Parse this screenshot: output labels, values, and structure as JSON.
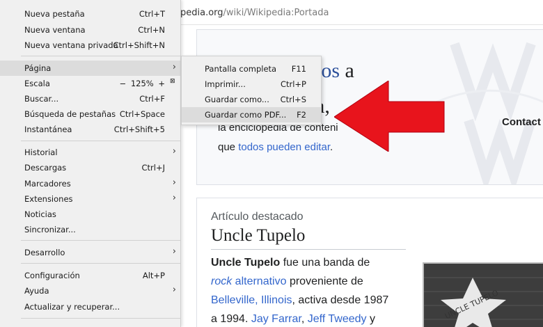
{
  "url": {
    "host_partial": "pedia.org",
    "path": "/wiki/Wikipedia:Portada"
  },
  "welcome": {
    "title_link": "los",
    "title_tail": " a",
    "line2": "a,",
    "line3": "la enciclopedia de conteni",
    "line4_pre": "que ",
    "line4_link": "todos pueden editar",
    "line4_post": ".",
    "contact": "Contact"
  },
  "featured": {
    "heading": "Artículo destacado",
    "title": "Uncle Tupelo",
    "line1_bold": "Uncle Tupelo",
    "line1_rest": " fue una banda de",
    "line2_link_i": "rock",
    "line2_link": " alternativo",
    "line2_rest": " proveniente de",
    "line3_link": "Belleville, Illinois",
    "line3_rest": ", activa desde 1987",
    "line4_pre": "a 1994. ",
    "line4_link1": "Jay Farrar",
    "line4_sep": ", ",
    "line4_link2": "Jeff Tweedy",
    "line4_post": " y",
    "image_text": "UNCLE TUPELO"
  },
  "menu": {
    "new_tab": "Nueva pestaña",
    "new_tab_key": "Ctrl+T",
    "new_window": "Nueva ventana",
    "new_window_key": "Ctrl+N",
    "new_private": "Nueva ventana privada",
    "new_private_key": "Ctrl+Shift+N",
    "page": "Página",
    "zoom": "Escala",
    "zoom_minus": "−",
    "zoom_value": "125%",
    "zoom_plus": "+",
    "find": "Buscar...",
    "find_key": "Ctrl+F",
    "tab_search": "Búsqueda de pestañas",
    "tab_search_key": "Ctrl+Space",
    "snapshot": "Instantánea",
    "snapshot_key": "Ctrl+Shift+5",
    "history": "Historial",
    "downloads": "Descargas",
    "downloads_key": "Ctrl+J",
    "bookmarks": "Marcadores",
    "extensions": "Extensiones",
    "news": "Noticias",
    "sync": "Sincronizar...",
    "developer": "Desarrollo",
    "settings": "Configuración",
    "settings_key": "Alt+P",
    "help": "Ayuda",
    "update": "Actualizar y recuperar..."
  },
  "submenu": {
    "fullscreen": "Pantalla completa",
    "fullscreen_key": "F11",
    "print": "Imprimir...",
    "print_key": "Ctrl+P",
    "save_as": "Guardar como...",
    "save_as_key": "Ctrl+S",
    "save_pdf": "Guardar como PDF...",
    "save_pdf_key": "F2"
  },
  "colors": {
    "highlight_arrow": "#e8141c",
    "menu_bg": "#f0f0f0",
    "link": "#3366cc"
  }
}
